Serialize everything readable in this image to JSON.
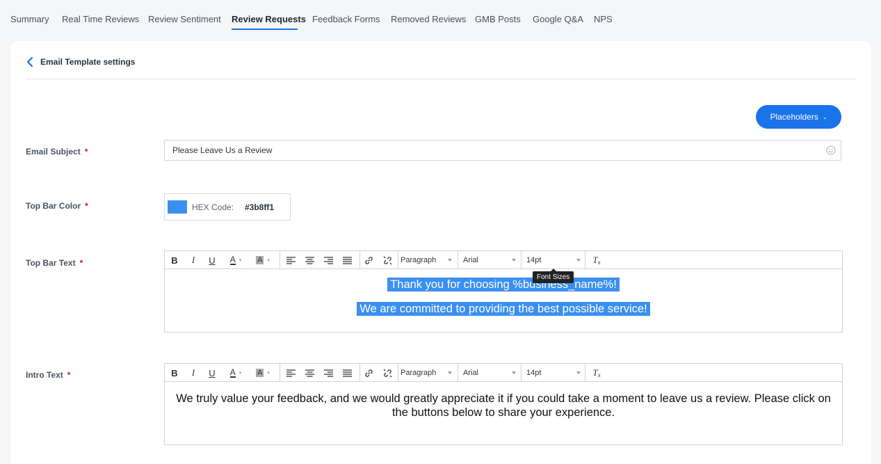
{
  "tabs": [
    {
      "label": "Summary"
    },
    {
      "label": "Real Time Reviews"
    },
    {
      "label": "Review Sentiment"
    },
    {
      "label": "Review Requests",
      "active": true
    },
    {
      "label": "Feedback Forms"
    },
    {
      "label": "Removed Reviews"
    },
    {
      "label": "GMB Posts"
    },
    {
      "label": "Google Q&A"
    },
    {
      "label": "NPS"
    }
  ],
  "page": {
    "title": "Email Template settings",
    "placeholders_label": "Placeholders"
  },
  "fields": {
    "subject": {
      "label": "Email Subject",
      "required_mark": "*",
      "value": "Please Leave Us a Review"
    },
    "top_bar_color": {
      "label": "Top Bar Color",
      "required_mark": "*",
      "hex_label": "HEX Code:",
      "hex_value": "#3b8ff1",
      "color": "#3b8ff1"
    },
    "top_bar_text": {
      "label": "Top Bar Text",
      "required_mark": "*",
      "lines": [
        "Thank you for choosing %business_name%!",
        "We are committed to providing the best possible service!"
      ]
    },
    "intro_text": {
      "label": "Intro Text",
      "required_mark": "*",
      "body": "We truly value your feedback, and we would greatly appreciate it if you could take a moment to leave us a review. Please click on the buttons below to share your experience."
    }
  },
  "toolbar": {
    "block_format": "Paragraph",
    "font_family": "Arial",
    "font_size": "14pt",
    "font_size_tooltip": "Font Sizes",
    "icons": [
      "bold-icon",
      "italic-icon",
      "underline-icon",
      "text-color-icon",
      "highlight-color-icon",
      "align-left-icon",
      "align-center-icon",
      "align-right-icon",
      "align-justify-icon",
      "link-icon",
      "unlink-icon",
      "clear-format-icon"
    ]
  },
  "colors": {
    "accent": "#1a73e8",
    "highlight": "#3b8ff1",
    "required": "#d0103a"
  }
}
